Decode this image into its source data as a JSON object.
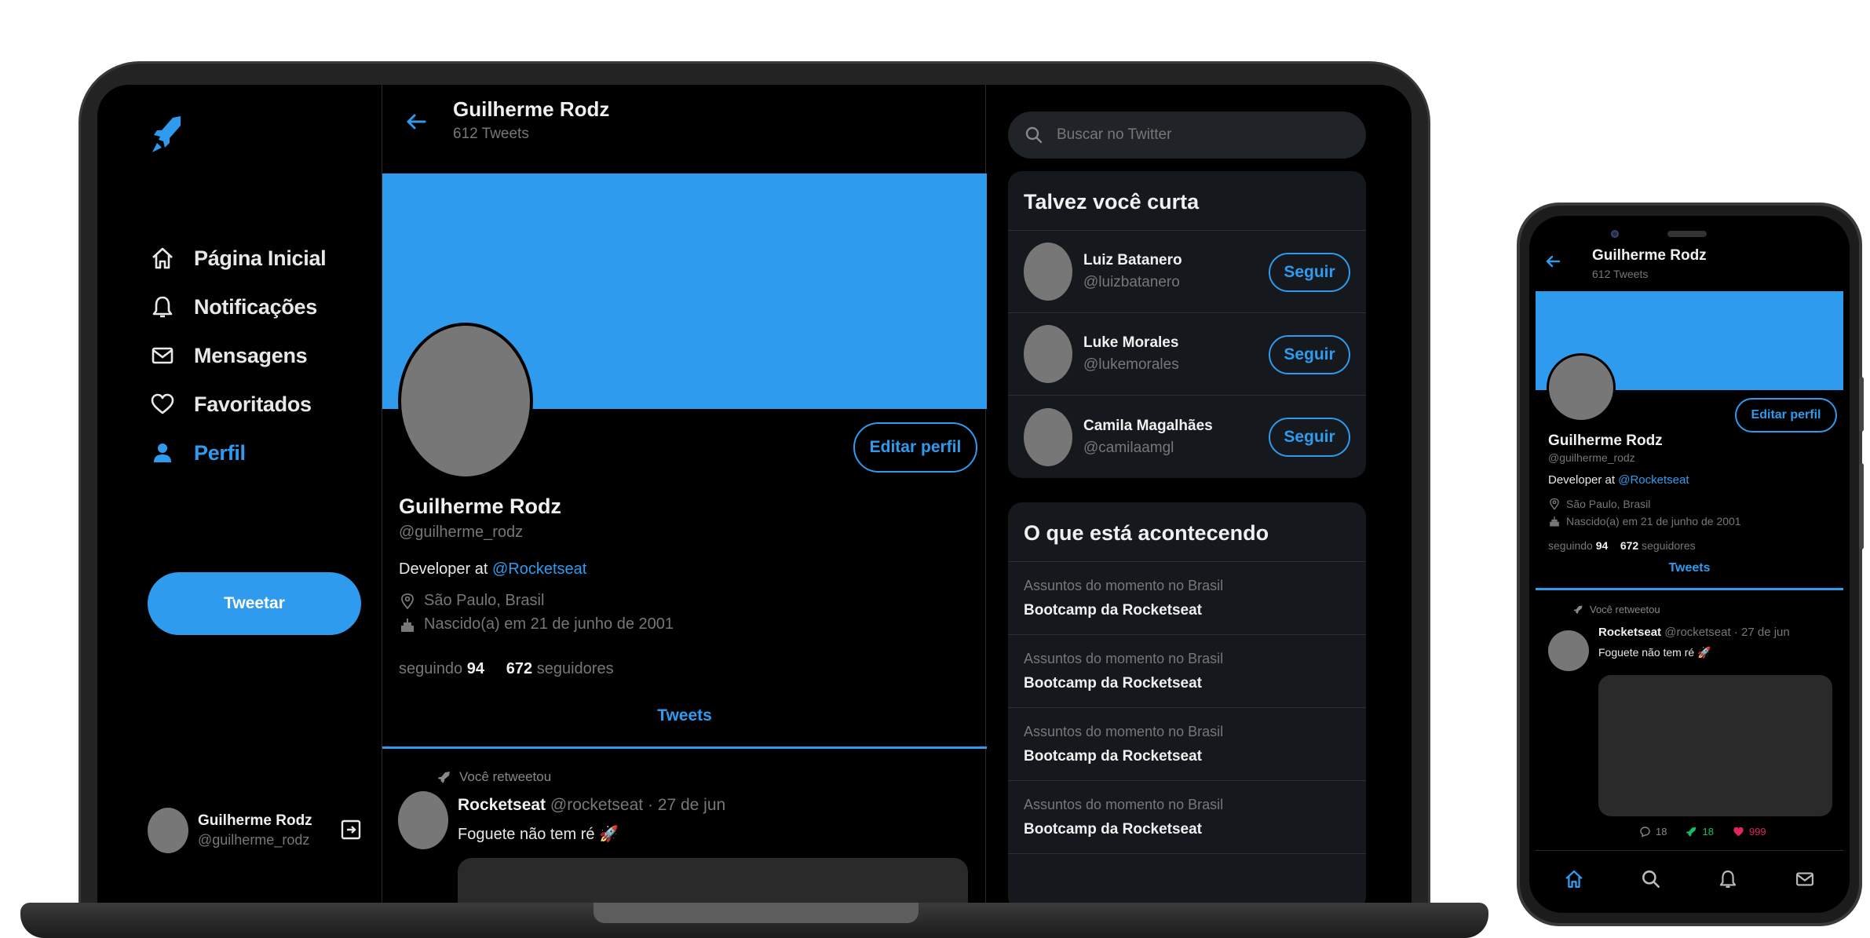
{
  "colors": {
    "accent": "#2f9bee",
    "bg": "#000000",
    "panel": "#15181c",
    "muted": "#777777",
    "like": "#e0245e"
  },
  "laptop": {
    "sidebar": {
      "logo_icon": "rocket-icon",
      "nav": [
        {
          "label": "Página Inicial",
          "icon": "home-icon"
        },
        {
          "label": "Notificações",
          "icon": "bell-icon"
        },
        {
          "label": "Mensagens",
          "icon": "mail-icon"
        },
        {
          "label": "Favoritados",
          "icon": "heart-icon"
        },
        {
          "label": "Perfil",
          "icon": "person-icon",
          "active": true
        }
      ],
      "tweet_button": "Tweetar",
      "user": {
        "name": "Guilherme Rodz",
        "handle": "@guilherme_rodz"
      }
    },
    "main": {
      "header": {
        "name": "Guilherme Rodz",
        "tweets_count": "612 Tweets"
      },
      "edit_profile": "Editar perfil",
      "profile": {
        "name": "Guilherme Rodz",
        "handle": "@guilherme_rodz",
        "bio_prefix": "Developer at ",
        "bio_link": "@Rocketseat",
        "location": "São Paulo, Brasil",
        "birth": "Nascido(a) em 21 de junho de 2001",
        "following_label": "seguindo",
        "following_count": "94",
        "followers_count": "672",
        "followers_label": "seguidores"
      },
      "tab": "Tweets",
      "tweet": {
        "retweet_label": "Você retweetou",
        "author": "Rocketseat",
        "handle": "@rocketseat",
        "sep": "·",
        "date": "27 de jun",
        "text": "Foguete não tem ré 🚀"
      }
    },
    "right": {
      "search_placeholder": "Buscar no Twitter",
      "suggest_title": "Talvez você curta",
      "suggestions": [
        {
          "name": "Luiz Batanero",
          "handle": "@luizbatanero",
          "button": "Seguir"
        },
        {
          "name": "Luke Morales",
          "handle": "@lukemorales",
          "button": "Seguir"
        },
        {
          "name": "Camila Magalhães",
          "handle": "@camilaamgl",
          "button": "Seguir"
        }
      ],
      "trends_title": "O que está acontecendo",
      "trends": [
        {
          "label": "Assuntos do momento no Brasil",
          "title": "Bootcamp da Rocketseat"
        },
        {
          "label": "Assuntos do momento no Brasil",
          "title": "Bootcamp da Rocketseat"
        },
        {
          "label": "Assuntos do momento no Brasil",
          "title": "Bootcamp da Rocketseat"
        },
        {
          "label": "Assuntos do momento no Brasil",
          "title": "Bootcamp da Rocketseat"
        }
      ]
    }
  },
  "phone": {
    "header": {
      "name": "Guilherme Rodz",
      "tweets_count": "612 Tweets"
    },
    "edit_profile": "Editar perfil",
    "profile": {
      "name": "Guilherme Rodz",
      "handle": "@guilherme_rodz",
      "bio_prefix": "Developer at ",
      "bio_link": "@Rocketseat",
      "location": "São Paulo, Brasil",
      "birth": "Nascido(a) em 21 de junho de 2001",
      "following_label": "seguindo",
      "following_count": "94",
      "followers_count": "672",
      "followers_label": "seguidores"
    },
    "tab": "Tweets",
    "tweet": {
      "retweet_label": "Você retweetou",
      "author": "Rocketseat",
      "handle": "@rocketseat",
      "sep": "·",
      "date": "27 de jun",
      "text": "Foguete não tem ré 🚀",
      "comments": "18",
      "retweets": "18",
      "likes": "999"
    },
    "tabbar": [
      "home-icon",
      "search-icon",
      "bell-icon",
      "mail-icon"
    ]
  }
}
